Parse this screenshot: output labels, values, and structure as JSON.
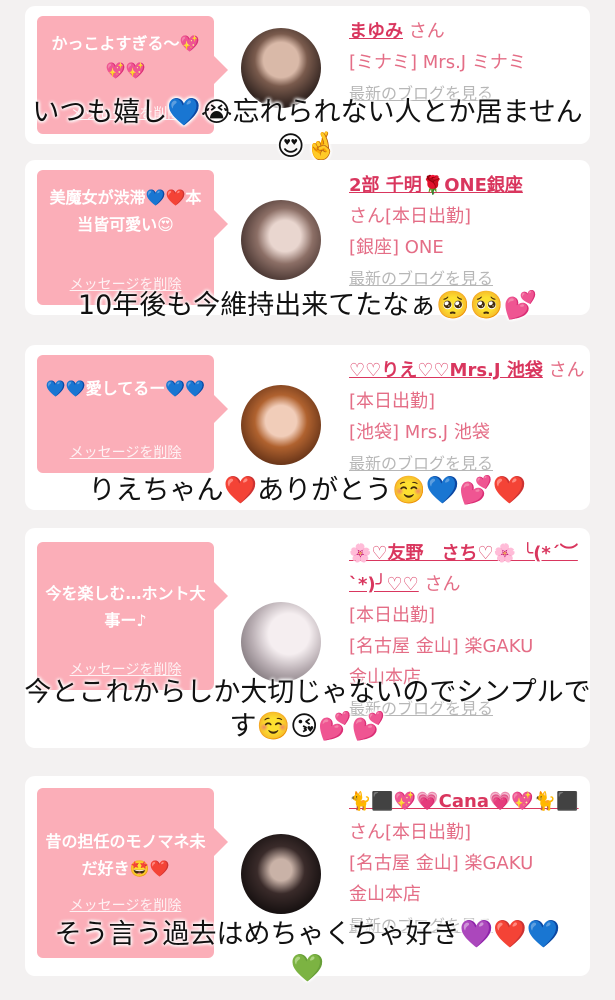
{
  "cards": [
    {
      "bubble_text": "かっこよすぎる〜💖💖💖",
      "delete_label": "メッセージを削除",
      "name": "まゆみ",
      "san": "さん",
      "line2": "[ミナミ] Mrs.J ミナミ",
      "line3": "",
      "line4": "",
      "blog": "最新のブログを見る",
      "caption": "いつも嬉し💙😭忘れられない人とか居ません😍🤞"
    },
    {
      "bubble_text": "美魔女が渋滞💙❤️本当皆可愛い😍",
      "delete_label": "メッセージを削除",
      "name": "2部 千明🌹ONE銀座",
      "san": "さん",
      "line2": "[本日出勤]",
      "line3": "[銀座] ONE",
      "line4": "",
      "blog": "最新のブログを見る",
      "caption": "10年後も今維持出来てたなぁ🥺🥺💕"
    },
    {
      "bubble_text": "💙💙愛してるー💙💙",
      "delete_label": "メッセージを削除",
      "name": "♡♡りえ♡♡Mrs.J 池袋",
      "san": "さん",
      "line2": "[本日出勤]",
      "line3": "[池袋] Mrs.J 池袋",
      "line4": "",
      "blog": "最新のブログを見る",
      "caption": "りえちゃん❤️ありがとう☺️💙💕❤️"
    },
    {
      "bubble_text": "今を楽しむ…ホント大事ー♪",
      "delete_label": "メッセージを削除",
      "name": "🌸♡友野　さち♡🌸 ╰(*´︶`*)╯♡♡",
      "san": "さん",
      "line2": "[本日出勤]",
      "line3": "[名古屋 金山] 楽GAKU",
      "line4": "金山本店",
      "blog": "最新のブログを見る",
      "caption": "今とこれからしか大切じゃないのでシンプルです☺️😘💕💕"
    },
    {
      "bubble_text": "昔の担任のモノマネ未だ好き🤩❤️",
      "delete_label": "メッセージを削除",
      "name": "🐈⬛💖💗Cana💗💖🐈⬛",
      "san": "さん",
      "line2": "[本日出勤]",
      "line3": "[名古屋 金山] 楽GAKU",
      "line4": "金山本店",
      "blog": "最新のブログを見る",
      "caption": "そう言う過去はめちゃくちゃ好き💜❤️💙💚"
    }
  ]
}
